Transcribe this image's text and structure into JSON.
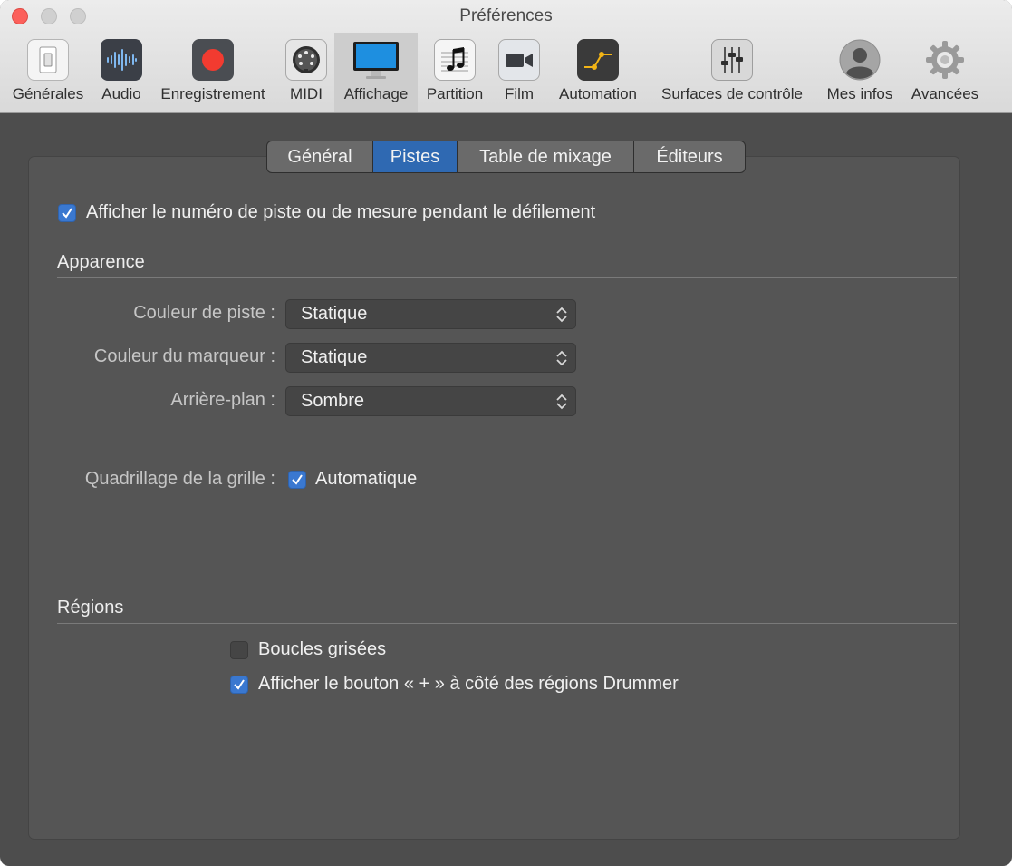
{
  "window": {
    "title": "Préférences"
  },
  "toolbar": {
    "items": [
      {
        "label": "Générales",
        "icon": "switch-icon"
      },
      {
        "label": "Audio",
        "icon": "waveform-icon"
      },
      {
        "label": "Enregistrement",
        "icon": "record-icon"
      },
      {
        "label": "MIDI",
        "icon": "midi-connector-icon"
      },
      {
        "label": "Affichage",
        "icon": "display-icon",
        "selected": true
      },
      {
        "label": "Partition",
        "icon": "music-note-icon"
      },
      {
        "label": "Film",
        "icon": "video-camera-icon"
      },
      {
        "label": "Automation",
        "icon": "automation-curve-icon"
      },
      {
        "label": "Surfaces de contrôle",
        "icon": "faders-icon"
      },
      {
        "label": "Mes infos",
        "icon": "user-silhouette-icon"
      },
      {
        "label": "Avancées",
        "icon": "gear-icon"
      }
    ]
  },
  "tabs": {
    "items": [
      "Général",
      "Pistes",
      "Table de mixage",
      "Éditeurs"
    ],
    "selected": "Pistes"
  },
  "main": {
    "show_track_number": {
      "label": "Afficher le numéro de piste ou de mesure pendant le défilement",
      "checked": true
    },
    "appearance": {
      "heading": "Apparence",
      "track_color": {
        "label": "Couleur de piste :",
        "value": "Statique"
      },
      "marker_color": {
        "label": "Couleur du marqueur :",
        "value": "Statique"
      },
      "background": {
        "label": "Arrière-plan :",
        "value": "Sombre"
      },
      "grid": {
        "label": "Quadrillage de la grille :",
        "option": "Automatique",
        "checked": true
      }
    },
    "regions": {
      "heading": "Régions",
      "gray_loops": {
        "label": "Boucles grisées",
        "checked": false
      },
      "drummer_button": {
        "label": "Afficher le bouton « + » à côté des régions Drummer",
        "checked": true
      }
    }
  },
  "colors": {
    "accent": "#2f69b2",
    "panel": "#555555",
    "background": "#4d4d4d",
    "close_button": "#fc605b"
  }
}
